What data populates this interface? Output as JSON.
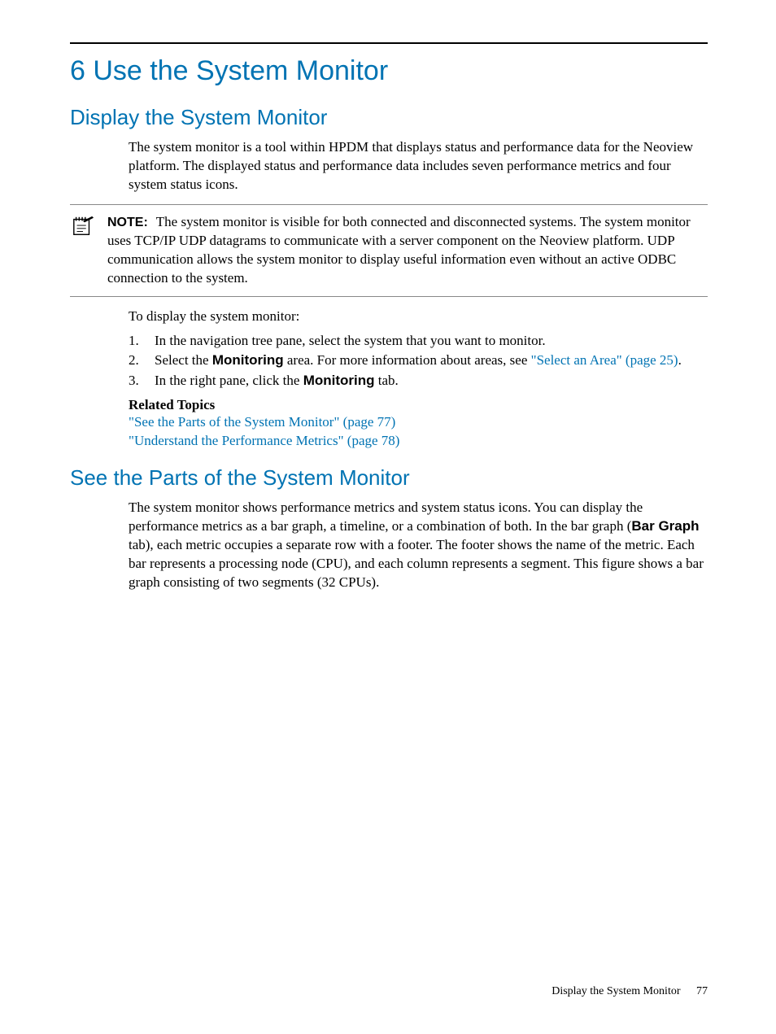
{
  "chapter": {
    "title": "6 Use the System Monitor"
  },
  "section1": {
    "title": "Display the System Monitor",
    "intro": "The system monitor is a tool within HPDM that displays status and performance data for the Neoview platform. The displayed status and performance data includes seven performance metrics and four system status icons.",
    "note_label": "NOTE:",
    "note_text": "The system monitor is visible for both connected and disconnected systems. The system monitor uses TCP/IP UDP datagrams to communicate with a server component on the Neoview platform. UDP communication allows the system monitor to display useful information even without an active ODBC connection to the system.",
    "steps_intro": "To display the system monitor:",
    "step1": "In the navigation tree pane, select the system that you want to monitor.",
    "step2_a": "Select the ",
    "step2_bold": "Monitoring",
    "step2_b": " area. For more information about areas, see ",
    "step2_link": "\"Select an Area\" (page 25)",
    "step2_c": ".",
    "step3_a": "In the right pane, click the ",
    "step3_bold": "Monitoring",
    "step3_b": " tab.",
    "related_heading": "Related Topics",
    "related_link1": "\"See the Parts of the System Monitor\" (page 77)",
    "related_link2": "\"Understand the Performance Metrics\" (page 78)"
  },
  "section2": {
    "title": "See the Parts of the System Monitor",
    "para_a": "The system monitor shows performance metrics and system status icons. You can display the performance metrics as a bar graph, a timeline, or a combination of both. In the bar graph (",
    "para_bold1": "Bar Graph",
    "para_b": " tab), each metric occupies a separate row with a footer. The footer shows the name of the metric. Each bar represents a processing node (CPU), and each column represents a segment. This figure shows a bar graph consisting of two segments (32 CPUs)."
  },
  "footer": {
    "text": "Display the System Monitor",
    "page": "77"
  }
}
